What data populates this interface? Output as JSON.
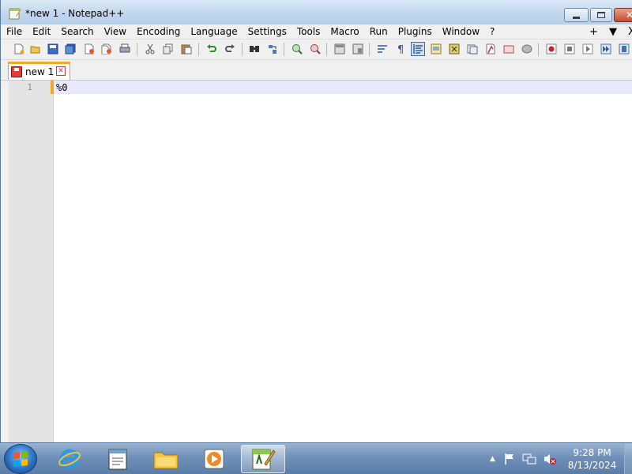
{
  "window": {
    "title": "*new 1 - Notepad++",
    "close_glyph": "✕"
  },
  "menu": {
    "items": [
      "File",
      "Edit",
      "Search",
      "View",
      "Encoding",
      "Language",
      "Settings",
      "Tools",
      "Macro",
      "Run",
      "Plugins",
      "Window",
      "?"
    ],
    "plus": "+",
    "dropdown": "▼",
    "close": "X"
  },
  "toolbar": {
    "icons": [
      "new-file-icon",
      "open-file-icon",
      "save-icon",
      "save-all-icon",
      "close-icon",
      "close-all-icon",
      "print-icon",
      "cut-icon",
      "copy-icon",
      "paste-icon",
      "undo-icon",
      "redo-icon",
      "find-icon",
      "replace-icon",
      "zoom-in-icon",
      "zoom-out-icon",
      "sync-vertical-icon",
      "sync-horizontal-icon",
      "word-wrap-icon",
      "show-all-chars-icon",
      "indent-guide-icon",
      "doc-map-icon",
      "function-list-icon",
      "folder-as-workspace-icon",
      "monitoring-icon",
      "record-macro-icon",
      "stop-macro-icon",
      "playback-macro-icon",
      "run-macro-multiple-icon",
      "save-macro-icon"
    ]
  },
  "tabs": [
    {
      "label": "new 1",
      "close": "✕",
      "modified": true
    }
  ],
  "editor": {
    "lines": [
      {
        "number": "1",
        "text": "%0"
      }
    ]
  },
  "taskbar": {
    "apps": [
      "internet-explorer-icon",
      "notepad-icon",
      "file-explorer-icon",
      "media-player-icon",
      "notepad-plus-plus-icon"
    ],
    "clock_time": "9:28 PM",
    "clock_date": "8/13/2024",
    "tray_arrow": "▲"
  },
  "colors": {
    "modified_tab_accent": "#f5a623",
    "current_line": "#e8e8ff",
    "gutter": "#e4e4e4"
  }
}
